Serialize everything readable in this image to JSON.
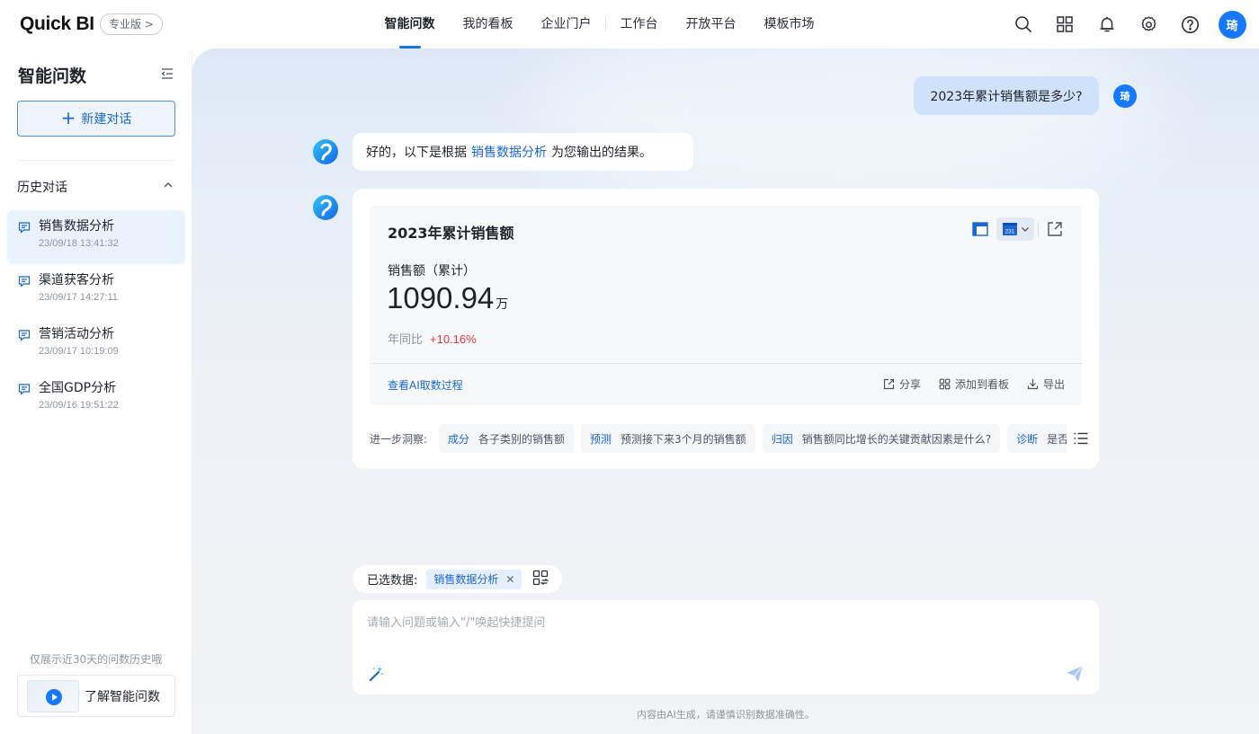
{
  "header": {
    "logo": "Quick BI",
    "edition": "专业版 >",
    "nav": [
      {
        "label": "智能问数",
        "active": true
      },
      {
        "label": "我的看板",
        "active": false
      },
      {
        "label": "企业门户",
        "active": false
      },
      {
        "label": "工作台",
        "active": false
      },
      {
        "label": "开放平台",
        "active": false
      },
      {
        "label": "模板市场",
        "active": false
      }
    ],
    "icons": [
      "search-icon",
      "apps-grid-icon",
      "bell-icon",
      "gear-icon",
      "help-icon"
    ],
    "avatar_initial": "琦",
    "accent_color": "#1677ff"
  },
  "sidebar": {
    "title": "智能问数",
    "new_chat_label": "新建对话",
    "history_title": "历史对话",
    "history": [
      {
        "name": "销售数据分析",
        "time": "23/09/18 13:41:32",
        "active": true
      },
      {
        "name": "渠道获客分析",
        "time": "23/09/17 14:27:11",
        "active": false
      },
      {
        "name": "营销活动分析",
        "time": "23/09/17 10:19:09",
        "active": false
      },
      {
        "name": "全国GDP分析",
        "time": "23/09/16 19:51:22",
        "active": false
      }
    ],
    "note": "仅展示近30天的问数历史哦",
    "learn_label": "了解智能问数"
  },
  "chat": {
    "user_question": "2023年累计销售额是多少?",
    "user_initial": "琦",
    "bot_reply_prefix": "好的，以下是根据",
    "bot_reply_link": "销售数据分析",
    "bot_reply_suffix": "为您输出的结果。"
  },
  "kpi_card": {
    "title": "2023年累计销售额",
    "metric_label": "销售额（累计）",
    "value": "1090.94",
    "unit": "万",
    "yoy_label": "年同比",
    "yoy_value": "+10.16%",
    "yoy_color": "#e5353c",
    "view_process": "查看AI取数过程",
    "actions": [
      "分享",
      "添加到看板",
      "导出"
    ],
    "chart_type_badge": "231"
  },
  "insights": {
    "label": "进一步洞察:",
    "chips": [
      {
        "tag": "成分",
        "text": "各子类别的销售额"
      },
      {
        "tag": "预测",
        "text": "预测接下来3个月的销售额"
      },
      {
        "tag": "归因",
        "text": "销售额同比增长的关键贡献因素是什么?"
      },
      {
        "tag": "诊断",
        "text": "是否有异常"
      }
    ]
  },
  "input": {
    "selected_label": "已选数据:",
    "selected_dataset": "销售数据分析",
    "placeholder": "请输入问题或输入\"/\"唤起快捷提问",
    "value": "",
    "disclaimer": "内容由AI生成，请谨慎识别数据准确性。"
  }
}
